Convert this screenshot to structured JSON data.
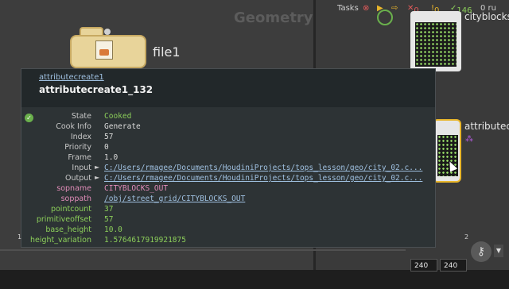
{
  "network": {
    "context_label": "Geometry",
    "file_node_label": "file1"
  },
  "tasks_bar": {
    "label": "Tasks",
    "count_red": "0",
    "count_yellow": "0",
    "count_green": "146",
    "count_gray": "0 ru"
  },
  "nodes": {
    "city_label": "cityblocks",
    "attr_label": "attributecrea"
  },
  "popup": {
    "node_type": "attributecreate1",
    "title": "attributecreate1_132",
    "rows": [
      {
        "key": "State",
        "value": "Cooked"
      },
      {
        "key": "Cook Info",
        "value": "Generate"
      },
      {
        "key": "Index",
        "value": "57"
      },
      {
        "key": "Priority",
        "value": "0"
      },
      {
        "key": "Frame",
        "value": "1.0"
      },
      {
        "key": "Input",
        "value": "C:/Users/rmagee/Documents/HoudiniProjects/tops_lesson/geo/city_02.c..."
      },
      {
        "key": "Output",
        "value": "C:/Users/rmagee/Documents/HoudiniProjects/tops_lesson/geo/city_02.c..."
      },
      {
        "key": "sopname",
        "value": "CITYBLOCKS_OUT"
      },
      {
        "key": "soppath",
        "value": "/obj/street_grid/CITYBLOCKS_OUT"
      },
      {
        "key": "pointcount",
        "value": "37"
      },
      {
        "key": "primitiveoffset",
        "value": "57"
      },
      {
        "key": "base_height",
        "value": "10.0"
      },
      {
        "key": "height_variation",
        "value": "1.5764617919921875"
      }
    ]
  },
  "timeline": {
    "tick_left": "1",
    "tick_right": "2",
    "end_frame": "240",
    "end_frame_2": "240"
  },
  "colors": {
    "accent_green": "#8ccf5a",
    "accent_pink": "#e08cb8",
    "link_blue": "#9fc0e0",
    "node_yellow": "#e9b62b"
  }
}
